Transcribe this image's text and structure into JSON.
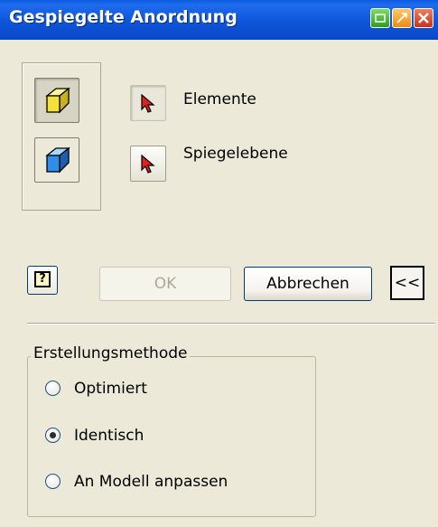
{
  "window": {
    "title": "Gespiegelte Anordnung"
  },
  "selectors": {
    "elements_label": "Elemente",
    "plane_label": "Spiegelebene"
  },
  "buttons": {
    "help_glyph": "?",
    "ok_label": "OK",
    "cancel_label": "Abbrechen",
    "expand_label": "<<"
  },
  "creation_method": {
    "legend": "Erstellungsmethode",
    "options": [
      {
        "label": "Optimiert",
        "checked": false
      },
      {
        "label": "Identisch",
        "checked": true
      },
      {
        "label": "An Modell anpassen",
        "checked": false
      }
    ]
  },
  "colors": {
    "titlebar": "#0a55d9",
    "dialog_bg": "#ece9d8",
    "cube_yellow": "#f4e23a",
    "cube_blue": "#2f8fe8",
    "cursor_red": "#e0201a"
  },
  "icons": {
    "mirror_features": "mirror-features-cube-icon",
    "mirror_solid": "mirror-solid-cube-icon",
    "select_cursor": "red-arrow-cursor-icon"
  }
}
